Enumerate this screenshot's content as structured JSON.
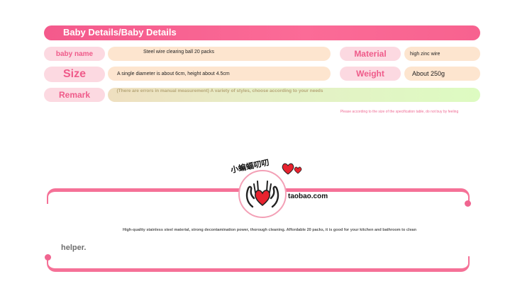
{
  "header": {
    "title": "Baby Details/Baby Details"
  },
  "details": {
    "name_label": "baby name",
    "name_value": "Steel wire clearing ball 20 packs",
    "material_label": "Material",
    "material_value": "high zinc wire",
    "size_label": "Size",
    "size_value": "A single diameter is about 6cm, height about 4.5cm",
    "weight_label": "Weight",
    "weight_value": "About 250g",
    "remark_label": "Remark",
    "remark_value": "(There are errors in manual measurement) A variety of styles, choose according to your needs"
  },
  "footnote": "Please according to the size of the specification table, do not buy by feeling",
  "brand": {
    "logo_text": "小蝙蝠叨叨",
    "site": "taobao.com"
  },
  "description": {
    "line1": "High-quality stainless steel material, strong decontamination power, thorough cleaning. Affordable 20 packs, it is good for your kitchen and bathroom to clean",
    "line2": "helper."
  },
  "colors": {
    "accent": "#f7628f",
    "label_bg": "#fcd9e1",
    "value_bg": "#fde5cf",
    "remark_bg": "#ddfbc1"
  }
}
